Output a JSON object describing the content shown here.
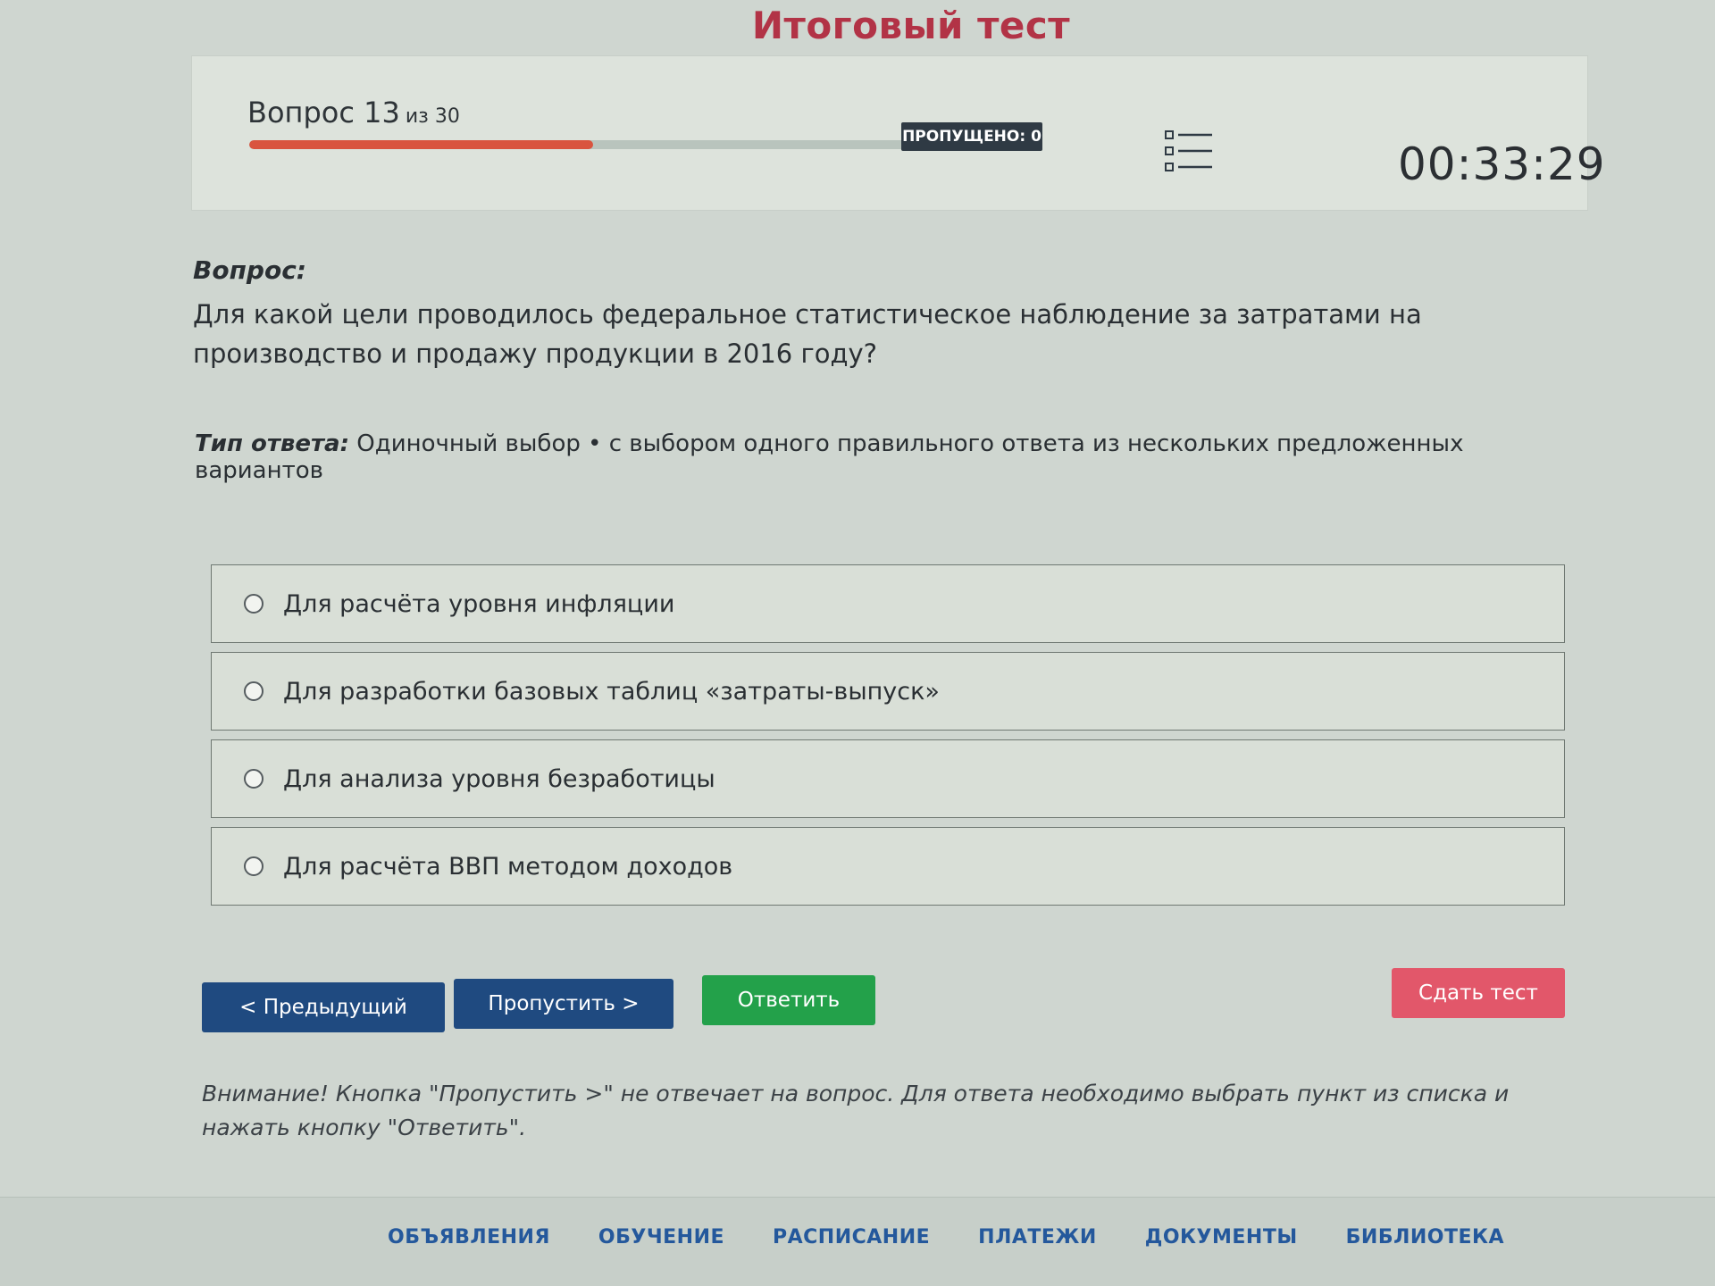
{
  "page": {
    "title": "Итоговый тест"
  },
  "header": {
    "question_label": "Вопрос 13",
    "question_of": "из 30",
    "progress": {
      "current": 13,
      "total": 30
    },
    "skipped_badge": "ПРОПУЩЕНО: 0",
    "list_icon": "list-icon",
    "timer": "00:33:29"
  },
  "question": {
    "label": "Вопрос:",
    "text": "Для какой цели проводилось федеральное статистическое наблюдение за затратами на производство и продажу продукции в 2016 году?",
    "answer_type_label": "Тип ответа:",
    "answer_type_value": "Одиночный выбор • с выбором одного правильного ответа из нескольких предложенных вариантов"
  },
  "options": [
    "Для расчёта уровня инфляции",
    "Для разработки базовых таблиц «затраты-выпуск»",
    "Для анализа уровня безработицы",
    "Для расчёта ВВП методом доходов"
  ],
  "buttons": {
    "prev": "< Предыдущий",
    "skip": "Пропустить >",
    "answer": "Ответить",
    "submit": "Сдать тест"
  },
  "notice": "Внимание! Кнопка \"Пропустить >\" не отвечает на вопрос. Для ответа необходимо выбрать пункт из списка и нажать кнопку \"Ответить\".",
  "footer": {
    "links": [
      "ОБЪЯВЛЕНИЯ",
      "ОБУЧЕНИЕ",
      "РАСПИСАНИЕ",
      "ПЛАТЕЖИ",
      "ДОКУМЕНТЫ",
      "БИБЛИОТЕКА"
    ]
  },
  "colors": {
    "title": "#b23346",
    "progress": "#d9543f",
    "primary": "#1f4a80",
    "success": "#23a14a",
    "danger": "#e2576a"
  }
}
